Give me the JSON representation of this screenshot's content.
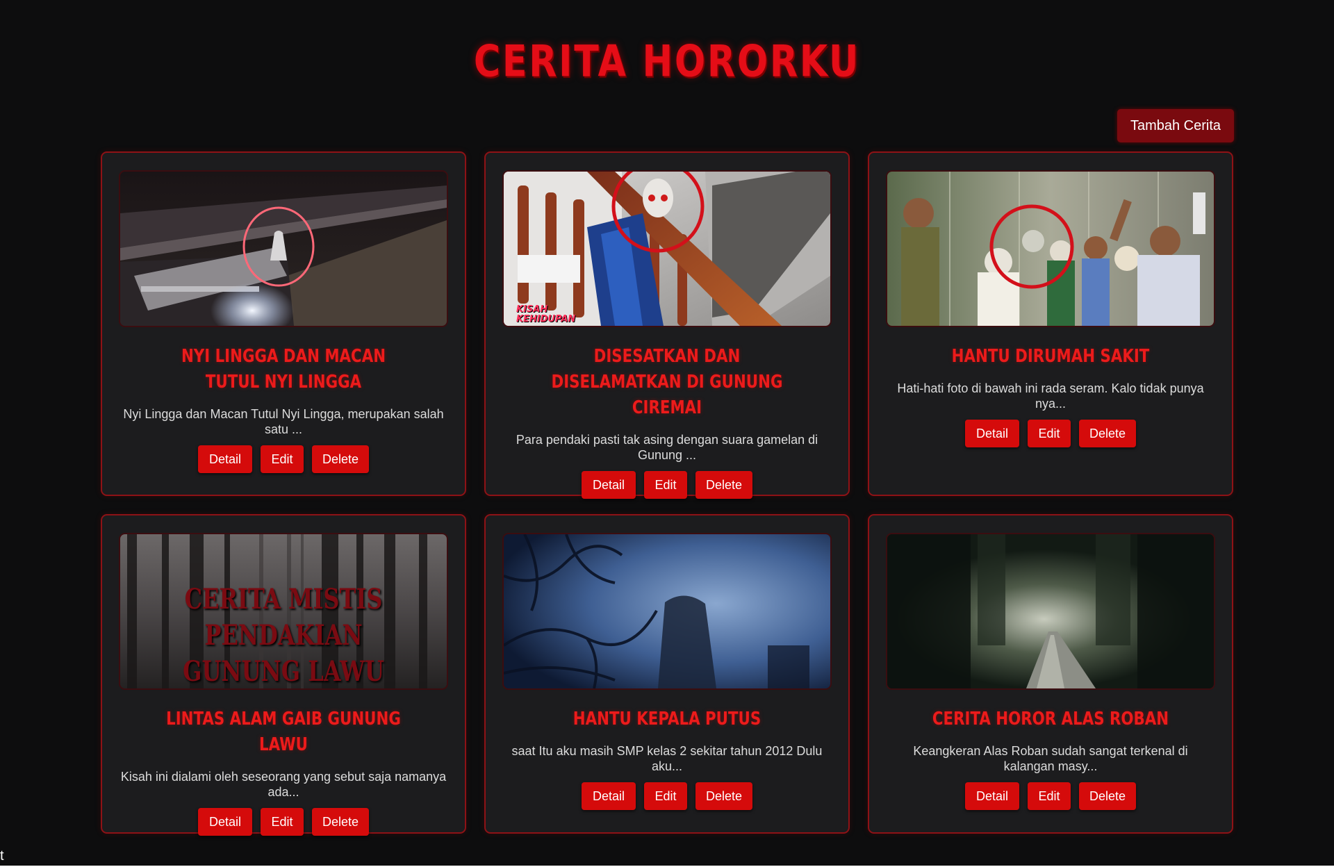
{
  "page": {
    "title": "CERITA HORORKU",
    "add_button_label": "Tambah Cerita",
    "corner_text": "t"
  },
  "buttons": {
    "detail": "Detail",
    "edit": "Edit",
    "delete": "Delete"
  },
  "stories": [
    {
      "title": "NYI LINGGA DAN MACAN TUTUL NYI LINGGA",
      "excerpt": "Nyi Lingga dan Macan Tutul Nyi Lingga, merupakan salah satu ...",
      "image": "night-figure-photo",
      "overlay_text": "",
      "caption": ""
    },
    {
      "title": "DISESATKAN DAN DISELAMATKAN DI GUNUNG CIREMAI",
      "excerpt": "Para pendaki pasti tak asing dengan suara gamelan di Gunung ...",
      "image": "staircase-ghost-photo",
      "overlay_text": "",
      "caption": "KISAH KEHIDUPAN"
    },
    {
      "title": "HANTU DIRUMAH SAKIT",
      "excerpt": "Hati-hati foto di bawah ini rada seram. Kalo tidak punya nya...",
      "image": "elevator-group-photo",
      "overlay_text": "",
      "caption": ""
    },
    {
      "title": "LINTAS ALAM GAIB GUNUNG LAWU",
      "excerpt": "Kisah ini dialami oleh seseorang yang sebut saja namanya ada...",
      "image": "misty-forest-photo",
      "overlay_text": "CERITA MISTIS PENDAKIAN GUNUNG LAWU",
      "caption": ""
    },
    {
      "title": "HANTU KEPALA PUTUS",
      "excerpt": "saat Itu aku masih SMP kelas 2 sekitar tahun 2012 Dulu aku...",
      "image": "headless-figure-photo",
      "overlay_text": "",
      "caption": ""
    },
    {
      "title": "CERITA HOROR ALAS ROBAN",
      "excerpt": "Keangkeran Alas Roban sudah sangat terkenal di kalangan masy...",
      "image": "forest-road-photo",
      "overlay_text": "",
      "caption": ""
    }
  ],
  "colors": {
    "background": "#0d0d0e",
    "card": "#1c1c1e",
    "card_border": "#8e1216",
    "accent_red": "#e50d17",
    "button_red": "#d50b0b",
    "add_button": "#7a0a0f"
  }
}
